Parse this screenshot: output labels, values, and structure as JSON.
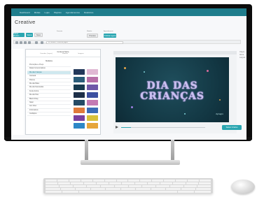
{
  "app": {
    "nav": [
      "Dashboard",
      "Mídias",
      "Lojas",
      "Playlists",
      "Agendamentos",
      "Relatórios"
    ],
    "title": "Creative"
  },
  "toolbar": {
    "buttons": [
      "Salvar Modelo",
      "Salvar",
      "Novo",
      "Preview",
      "Publicar agora"
    ],
    "labels": [
      "Formato",
      "Modelo",
      "Agendamento"
    ],
    "path_placeholder": "Ex: Modelo / Criativo de página"
  },
  "content_panel": {
    "heading": "Content Store",
    "tabs": [
      "Camadas (Layers)",
      "Modelos",
      "Imagens"
    ],
    "menu_header": "Modelos",
    "items": [
      "Promoções e Preço",
      "Datas Comemorativas",
      "Dia das Crianças",
      "Carnaval",
      "Páscoa",
      "Dia das Mães",
      "Dia dos Namorados",
      "Festa Junina",
      "Dia dos Pais",
      "Black Friday",
      "Natal",
      "Ano Novo",
      "Informativos",
      "Cardápios"
    ],
    "active_item": "Dia das Crianças"
  },
  "editor": {
    "canvas_text_line1": "DIA DAS",
    "canvas_text_line2": "CRIANÇAS",
    "brand": "dynagro",
    "save_label": "Salvar Criativo"
  },
  "right_panel": {
    "items": [
      "Objeto",
      "Altura",
      "Largura"
    ]
  },
  "colors": {
    "accent": "#2aa6b1",
    "nav": "#1f7d8c",
    "canvas_bg": "#123642",
    "canvas_title": "#c9bff0"
  }
}
